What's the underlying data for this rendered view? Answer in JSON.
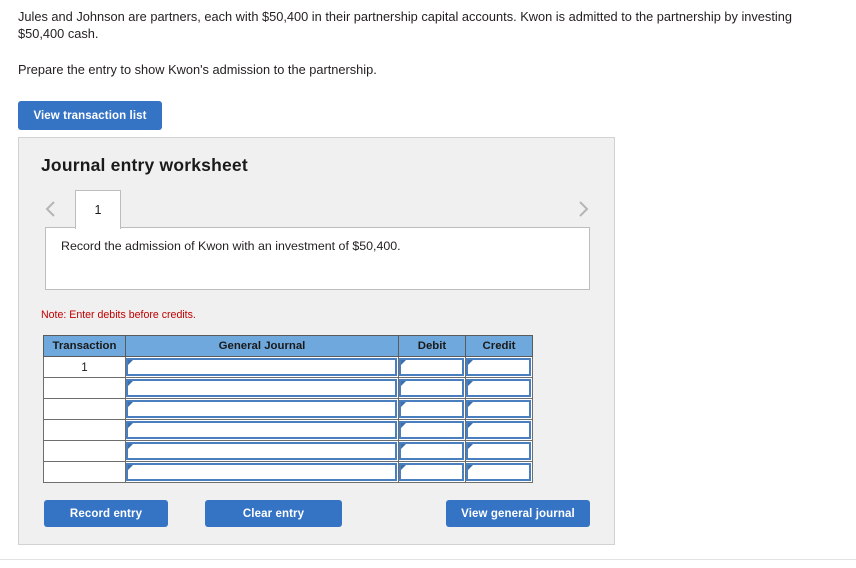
{
  "problem": {
    "paragraph_1": "Jules and Johnson are partners, each with $50,400 in their partnership capital accounts. Kwon is admitted to the partnership by investing $50,400 cash.",
    "paragraph_2": "Prepare the entry to show Kwon's admission to the partnership."
  },
  "toolbar": {
    "view_transaction_list_label": "View transaction list"
  },
  "worksheet": {
    "title": "Journal entry worksheet",
    "pager": {
      "prev_icon": "chevron-left-icon",
      "next_icon": "chevron-right-icon",
      "tabs": [
        {
          "label": "1",
          "active": true
        }
      ]
    },
    "instruction": "Record the admission of Kwon with an investment of $50,400.",
    "note": "Note: Enter debits before credits.",
    "table": {
      "columns": [
        "Transaction",
        "General Journal",
        "Debit",
        "Credit"
      ],
      "rows": [
        {
          "transaction": "1",
          "general_journal": "",
          "debit": "",
          "credit": ""
        },
        {
          "transaction": "",
          "general_journal": "",
          "debit": "",
          "credit": ""
        },
        {
          "transaction": "",
          "general_journal": "",
          "debit": "",
          "credit": ""
        },
        {
          "transaction": "",
          "general_journal": "",
          "debit": "",
          "credit": ""
        },
        {
          "transaction": "",
          "general_journal": "",
          "debit": "",
          "credit": ""
        },
        {
          "transaction": "",
          "general_journal": "",
          "debit": "",
          "credit": ""
        }
      ]
    },
    "actions": {
      "record_entry_label": "Record entry",
      "clear_entry_label": "Clear entry",
      "view_general_journal_label": "View general journal"
    }
  },
  "colors": {
    "button_blue": "#3573c4",
    "table_header_blue": "#6fa8dc",
    "input_border_blue": "#4a7fbf",
    "note_red": "#c00000",
    "panel_gray": "#f0f0f0"
  }
}
